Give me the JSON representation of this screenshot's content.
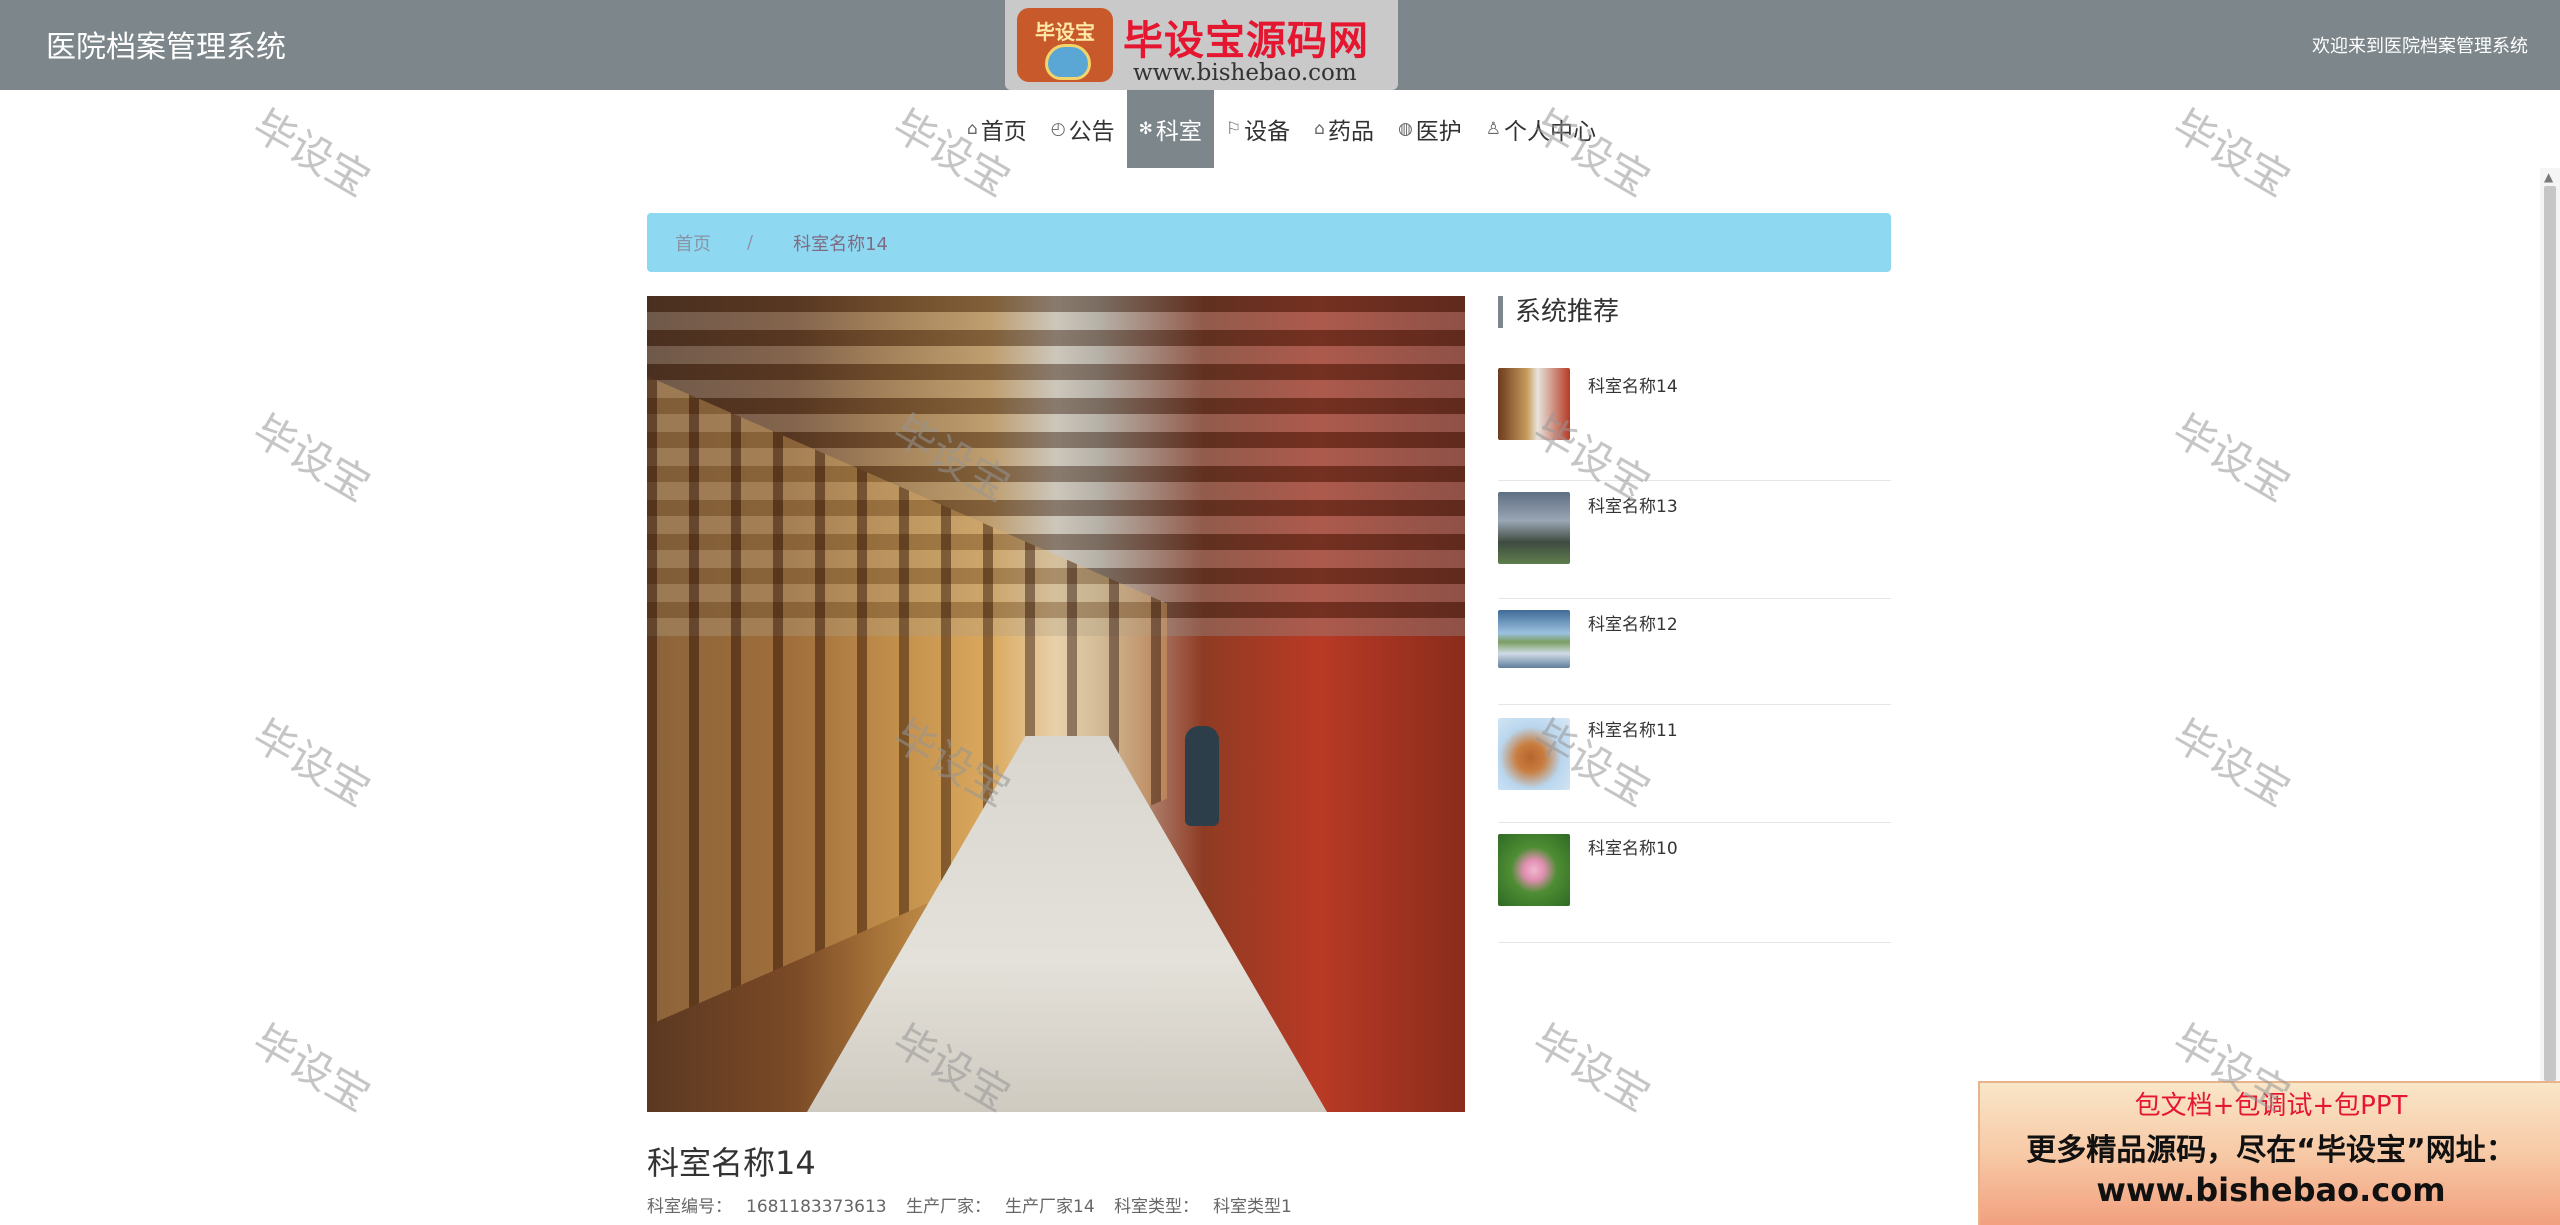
{
  "header": {
    "system_title": "医院档案管理系统",
    "welcome": "欢迎来到医院档案管理系统"
  },
  "logo": {
    "badge_text": "毕设宝",
    "name": "毕设宝源码网",
    "url": "www.bishebao.com"
  },
  "nav": {
    "items": [
      {
        "label": "首页",
        "icon": "home-icon",
        "glyph": "⌂"
      },
      {
        "label": "公告",
        "icon": "dashboard-icon",
        "glyph": "◴"
      },
      {
        "label": "科室",
        "icon": "snowflake-icon",
        "glyph": "✻"
      },
      {
        "label": "设备",
        "icon": "flag-icon",
        "glyph": "⚐"
      },
      {
        "label": "药品",
        "icon": "shop-icon",
        "glyph": "⌂"
      },
      {
        "label": "医护",
        "icon": "palette-icon",
        "glyph": "◍"
      },
      {
        "label": "个人中心",
        "icon": "user-icon",
        "glyph": "♙"
      }
    ],
    "active": "科室",
    "active_color": "#7d878b"
  },
  "breadcrumb": {
    "home": "首页",
    "separator": "/",
    "current": "科室名称14"
  },
  "detail": {
    "title": "科室名称14",
    "meta": {
      "id_label": "科室编号：",
      "id_value": "1681183373613",
      "maker_label": "生产厂家：",
      "maker_value": "生产厂家14",
      "type_label": "科室类型：",
      "type_value": "科室类型1"
    }
  },
  "sidebar": {
    "title": "系统推荐",
    "items": [
      {
        "name": "科室名称14"
      },
      {
        "name": "科室名称13"
      },
      {
        "name": "科室名称12"
      },
      {
        "name": "科室名称11"
      },
      {
        "name": "科室名称10"
      }
    ]
  },
  "promo": {
    "line1": "包文档+包调试+包PPT",
    "line2": "更多精品源码，尽在“毕设宝”网址：",
    "line3": "www.bishebao.com"
  },
  "watermark": {
    "text": "毕设宝"
  },
  "colors": {
    "header_bg": "#7d878b",
    "breadcrumb_bg": "#8ed8f2",
    "promo_red": "#e5162f"
  }
}
